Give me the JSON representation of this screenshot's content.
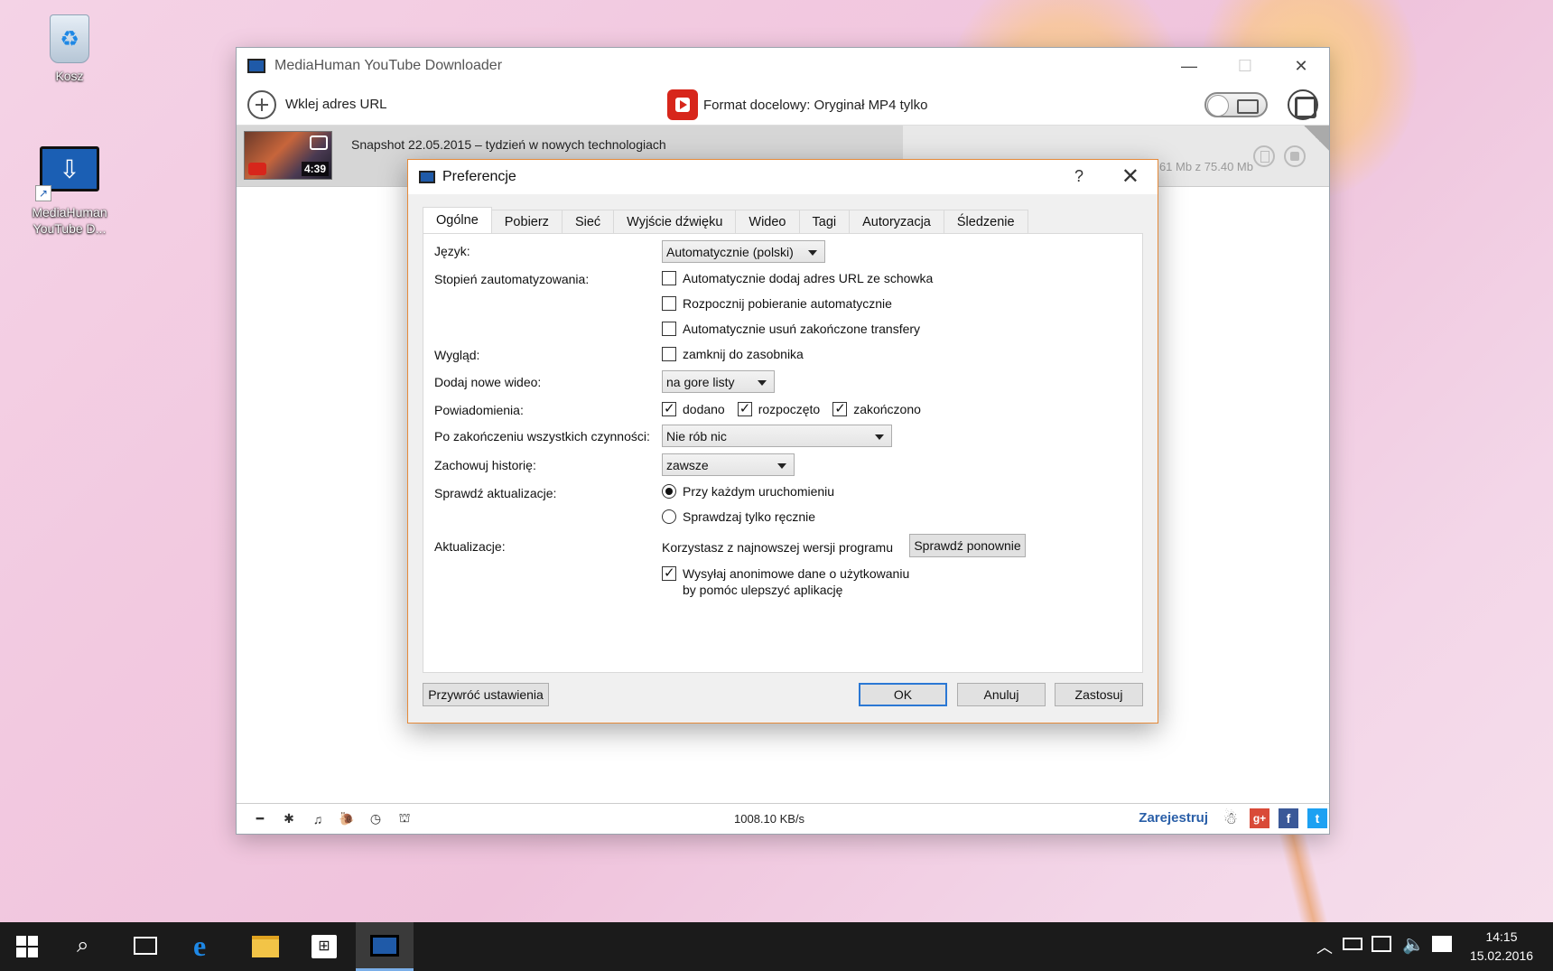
{
  "desktop": {
    "icons": [
      {
        "label": "Kosz"
      },
      {
        "label": "MediaHuman YouTube D..."
      }
    ]
  },
  "main_window": {
    "title": "MediaHuman YouTube Downloader",
    "toolbar": {
      "paste_url_label": "Wklej adres URL",
      "format_label": "Format docelowy: Oryginał MP4 tylko"
    },
    "item": {
      "title": "Snapshot 22.05.2015 – tydzień w nowych technologiach",
      "duration": "4:39",
      "size": "61 Mb z 75.40 Mb"
    },
    "statusbar": {
      "speed": "1008.10 KB/s",
      "register": "Zarejestruj"
    }
  },
  "dialog": {
    "title": "Preferencje",
    "help": "?",
    "tabs": [
      "Ogólne",
      "Pobierz",
      "Sieć",
      "Wyjście dźwięku",
      "Wideo",
      "Tagi",
      "Autoryzacja",
      "Śledzenie"
    ],
    "active_tab": "Ogólne",
    "language": {
      "label": "Język:",
      "value": "Automatycznie (polski)"
    },
    "automation": {
      "label": "Stopień zautomatyzowania:",
      "options": [
        {
          "text": "Automatycznie dodaj adres URL ze schowka",
          "checked": false
        },
        {
          "text": "Rozpocznij pobieranie automatycznie",
          "checked": false
        },
        {
          "text": "Automatycznie usuń zakończone transfery",
          "checked": false
        }
      ]
    },
    "appearance": {
      "label": "Wygląd:",
      "option": "zamknij do zasobnika",
      "checked": false
    },
    "add_new": {
      "label": "Dodaj nowe wideo:",
      "value": "na gore listy"
    },
    "notifications": {
      "label": "Powiadomienia:",
      "options": [
        {
          "text": "dodano",
          "checked": true
        },
        {
          "text": "rozpoczęto",
          "checked": true
        },
        {
          "text": "zakończono",
          "checked": true
        }
      ]
    },
    "after_all": {
      "label": "Po zakończeniu wszystkich czynności:",
      "value": "Nie rób nic"
    },
    "history": {
      "label": "Zachowuj historię:",
      "value": "zawsze"
    },
    "check_updates": {
      "label": "Sprawdź aktualizacje:",
      "options": [
        {
          "text": "Przy każdym uruchomieniu",
          "checked": true
        },
        {
          "text": "Sprawdzaj tylko ręcznie",
          "checked": false
        }
      ]
    },
    "updates": {
      "label": "Aktualizacje:",
      "status": "Korzystasz z najnowszej wersji programu",
      "check_again": "Sprawdź ponownie",
      "anon_line1": "Wysyłaj anonimowe dane o użytkowaniu",
      "anon_line2": "by pomóc ulepszyć aplikację",
      "anon_checked": true
    },
    "buttons": {
      "restore": "Przywróć ustawienia",
      "ok": "OK",
      "cancel": "Anuluj",
      "apply": "Zastosuj"
    }
  },
  "taskbar": {
    "time": "14:15",
    "date": "15.02.2016"
  }
}
